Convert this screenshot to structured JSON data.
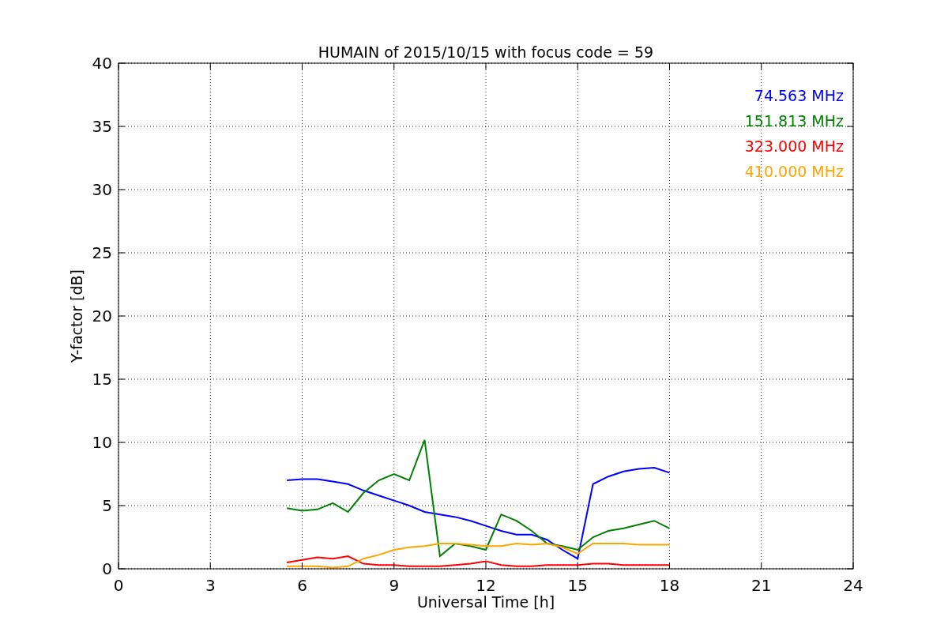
{
  "chart_data": {
    "type": "line",
    "grid": true,
    "title": "HUMAIN of 2015/10/15 with focus code = 59",
    "xlabel": "Universal Time [h]",
    "ylabel": "Y-factor [dB]",
    "xlim": [
      0,
      24
    ],
    "ylim": [
      0,
      40
    ],
    "xticks": [
      0,
      3,
      6,
      9,
      12,
      15,
      18,
      21,
      24
    ],
    "yticks": [
      0,
      5,
      10,
      15,
      20,
      25,
      30,
      35,
      40
    ],
    "x": [
      5.5,
      6,
      6.5,
      7,
      7.5,
      8,
      8.5,
      9,
      9.5,
      10,
      10.5,
      11,
      11.5,
      12,
      12.5,
      13,
      13.5,
      14,
      14.5,
      15,
      15.5,
      16,
      16.5,
      17,
      17.5,
      18
    ],
    "series": [
      {
        "name": "74.563 MHz",
        "color": "#0000ff",
        "values": [
          7.0,
          7.1,
          7.1,
          6.9,
          6.7,
          6.2,
          5.8,
          5.4,
          5.0,
          4.5,
          4.3,
          4.1,
          3.8,
          3.4,
          3.0,
          2.7,
          2.7,
          2.3,
          1.5,
          0.8,
          6.7,
          7.3,
          7.7,
          7.9,
          8.0,
          7.6
        ]
      },
      {
        "name": "151.813 MHz",
        "color": "#008000",
        "values": [
          4.8,
          4.6,
          4.7,
          5.2,
          4.5,
          6.0,
          7.0,
          7.5,
          7.0,
          10.2,
          1.0,
          2.0,
          1.8,
          1.5,
          4.3,
          3.8,
          3.0,
          2.0,
          1.8,
          1.5,
          2.5,
          3.0,
          3.2,
          3.5,
          3.8,
          3.2
        ]
      },
      {
        "name": "323.000 MHz",
        "color": "#ff0000",
        "values": [
          0.5,
          0.7,
          0.9,
          0.8,
          1.0,
          0.4,
          0.3,
          0.3,
          0.2,
          0.2,
          0.2,
          0.3,
          0.4,
          0.6,
          0.3,
          0.2,
          0.2,
          0.3,
          0.3,
          0.3,
          0.4,
          0.4,
          0.3,
          0.3,
          0.3,
          0.3
        ]
      },
      {
        "name": "410.000 MHz",
        "color": "#ffa500",
        "values": [
          0.2,
          0.2,
          0.2,
          0.1,
          0.2,
          0.8,
          1.1,
          1.5,
          1.7,
          1.8,
          2.0,
          2.0,
          1.9,
          1.8,
          1.8,
          2.0,
          1.9,
          2.0,
          1.7,
          1.2,
          2.0,
          2.0,
          2.0,
          1.9,
          1.9,
          1.9
        ]
      }
    ]
  }
}
